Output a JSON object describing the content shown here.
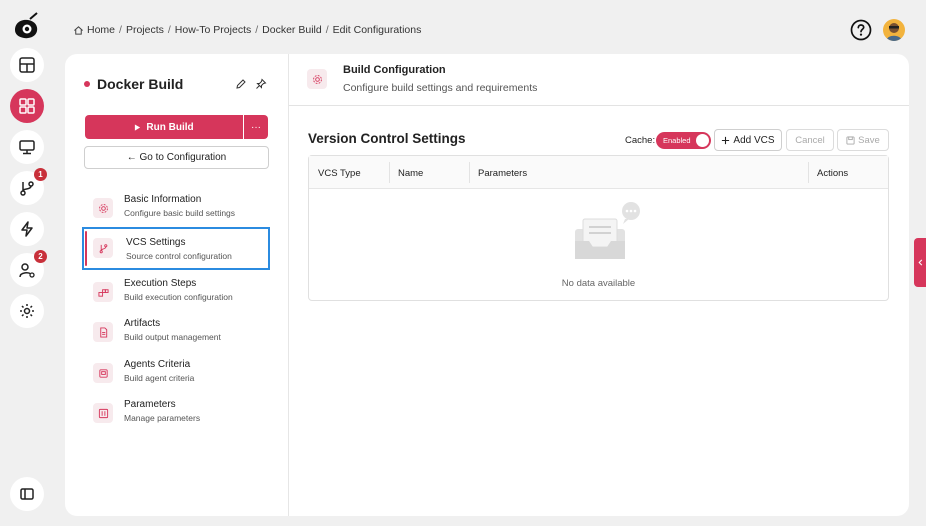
{
  "breadcrumb": {
    "items": [
      "Home",
      "Projects",
      "How-To Projects",
      "Docker Build",
      "Edit Configurations"
    ],
    "separator": "/"
  },
  "rail": {
    "badges": {
      "branches": "1",
      "users": "2"
    }
  },
  "project": {
    "title": "Docker Build",
    "run_label": "Run Build",
    "more_label": "···",
    "goto_label": "← Go to Configuration"
  },
  "nav": [
    {
      "title": "Basic Information",
      "subtitle": "Configure basic build settings",
      "icon": "gear-icon"
    },
    {
      "title": "VCS Settings",
      "subtitle": "Source control configuration",
      "icon": "branch-icon"
    },
    {
      "title": "Execution Steps",
      "subtitle": "Build execution configuration",
      "icon": "steps-icon"
    },
    {
      "title": "Artifacts",
      "subtitle": "Build output management",
      "icon": "file-icon"
    },
    {
      "title": "Agents Criteria",
      "subtitle": "Build agent criteria",
      "icon": "agent-icon"
    },
    {
      "title": "Parameters",
      "subtitle": "Manage parameters",
      "icon": "sliders-icon"
    }
  ],
  "section": {
    "title": "Build Configuration",
    "subtitle": "Configure build settings and requirements"
  },
  "vcs": {
    "heading": "Version Control Settings",
    "cache_label": "Cache:",
    "cache_state": "Enabled",
    "add_label": "Add VCS",
    "cancel_label": "Cancel",
    "save_label": "Save",
    "columns": [
      "VCS Type",
      "Name",
      "Parameters",
      "Actions"
    ],
    "empty_text": "No data available"
  },
  "colors": {
    "accent": "#d6365b",
    "selection_outline": "#2b8be0"
  }
}
